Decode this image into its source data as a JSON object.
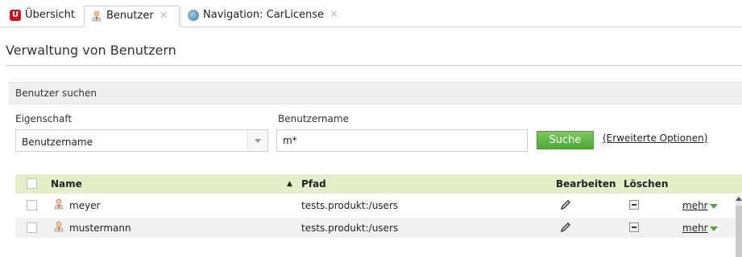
{
  "tabs": [
    {
      "label": "Übersicht",
      "icon": "app-logo-icon",
      "closable": false
    },
    {
      "label": "Benutzer",
      "icon": "user-icon",
      "closable": true,
      "active": true
    },
    {
      "label": "Navigation: CarLicense",
      "icon": "navigation-icon",
      "closable": true
    }
  ],
  "page": {
    "title": "Verwaltung von Benutzern"
  },
  "search": {
    "panel_title": "Benutzer suchen",
    "property_label": "Eigenschaft",
    "property_value": "Benutzername",
    "username_label": "Benutzername",
    "username_value": "m*",
    "search_button": "Suche",
    "advanced_link": "(Erweiterte Optionen)"
  },
  "table": {
    "columns": {
      "name": "Name",
      "path": "Pfad",
      "edit": "Bearbeiten",
      "delete": "Löschen"
    },
    "sort": {
      "column": "path",
      "direction": "ascending"
    },
    "rows": [
      {
        "name": "meyer",
        "path": "tests.produkt:/users",
        "more": "mehr"
      },
      {
        "name": "mustermann",
        "path": "tests.produkt:/users",
        "more": "mehr"
      }
    ]
  },
  "colors": {
    "accent_green": "#4fa63a",
    "header_green": "#e4efc9",
    "brand_red": "#d1101e"
  }
}
